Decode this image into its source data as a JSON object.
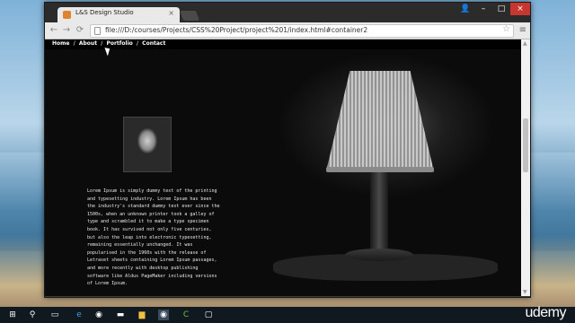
{
  "browser": {
    "tab_title": "L&S Design Studio",
    "tab_close": "×",
    "url": "file:///D:/courses/Projects/CSS%20Project/project%201/index.html#container2",
    "window_controls": {
      "user": "👤",
      "minimize": "–",
      "maximize": "□",
      "close": "×"
    },
    "nav": {
      "back": "←",
      "forward": "→",
      "reload": "⟳"
    },
    "star": "☆",
    "menu": "≡"
  },
  "site": {
    "nav": [
      "Home",
      "About",
      "Portfolio",
      "Contact"
    ],
    "separator": "/",
    "bio_text": "Lorem Ipsum is simply dummy text of the printing and typesetting industry. Lorem Ipsum has been the industry's standard dummy text ever since the 1500s, when an unknown printer took a galley of type and scrambled it to make a type specimen book. It has survived not only five centuries, but also the leap into electronic typesetting, remaining essentially unchanged. It was popularised in the 1960s with the release of Letraset sheets containing Lorem Ipsum passages, and more recently with desktop publishing software like Aldus PageMaker including versions of Lorem Ipsum."
  },
  "scrollbar": {
    "up": "▲",
    "down": "▼"
  },
  "taskbar": {
    "icons": [
      "windows-start",
      "search",
      "task-view",
      "edge",
      "chrome",
      "monitor",
      "file-explorer",
      "chrome-active",
      "camtasia",
      "code-editor"
    ],
    "win_glyph": "⊞",
    "search_glyph": "⚲",
    "task_glyph": "▭",
    "edge_glyph": "e",
    "chrome_glyph": "◉",
    "monitor_glyph": "▬",
    "folder_glyph": "▆",
    "chrome2_glyph": "◉",
    "camtasia_glyph": "C",
    "code_glyph": "▢",
    "watermark": "udemy"
  }
}
